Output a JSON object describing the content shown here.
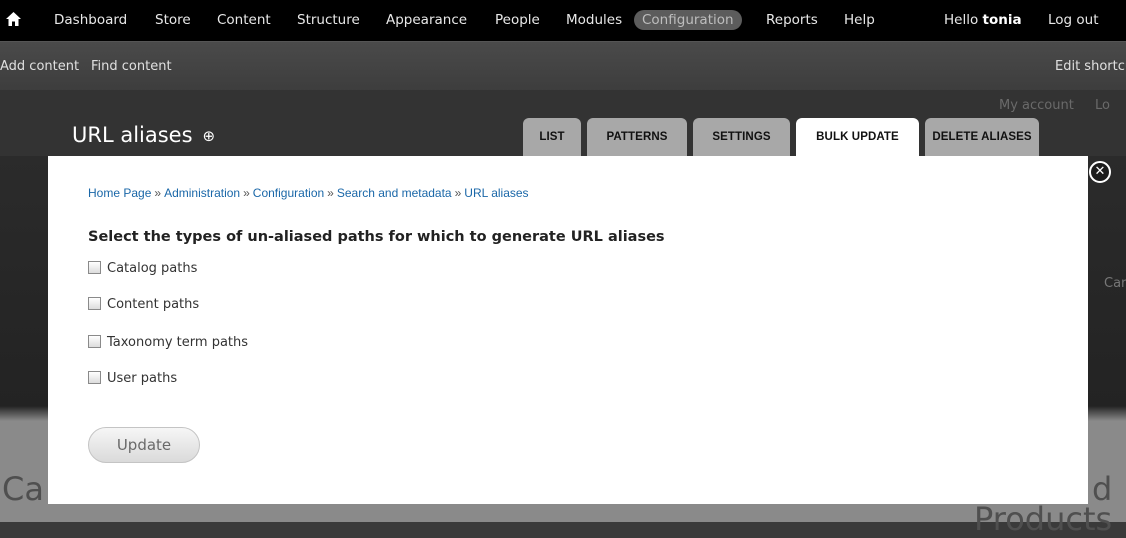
{
  "toolbar": {
    "items": [
      "Dashboard",
      "Store",
      "Content",
      "Structure",
      "Appearance",
      "People",
      "Modules",
      "Configuration",
      "Reports",
      "Help"
    ],
    "hello": "Hello",
    "username": "tonia",
    "logout": "Log out"
  },
  "shortcuts": {
    "add_content": "Add content",
    "find_content": "Find content",
    "edit_shortcuts": "Edit shortcuts"
  },
  "background": {
    "my_account": "My account",
    "log_prefix": "Lo",
    "cart": "Cart",
    "catalog": "Ca",
    "products": "Products",
    "d": "d"
  },
  "overlay": {
    "title": "URL aliases",
    "add_icon": "⊕",
    "tabs": [
      "LIST",
      "PATTERNS",
      "SETTINGS",
      "BULK UPDATE",
      "DELETE ALIASES"
    ],
    "active_tab": "BULK UPDATE",
    "close_icon": "✕"
  },
  "breadcrumb": [
    "Home Page",
    "Administration",
    "Configuration",
    "Search and metadata",
    "URL aliases"
  ],
  "breadcrumb_sep": "»",
  "form": {
    "title": "Select the types of un-aliased paths for which to generate URL aliases",
    "options": [
      "Catalog paths",
      "Content paths",
      "Taxonomy term paths",
      "User paths"
    ],
    "update_label": "Update"
  },
  "colors": {
    "link": "#1a67a8",
    "toolbar_bg": "#000000",
    "tab_bg": "#a8a8a8",
    "active_tab_bg": "#ffffff"
  }
}
